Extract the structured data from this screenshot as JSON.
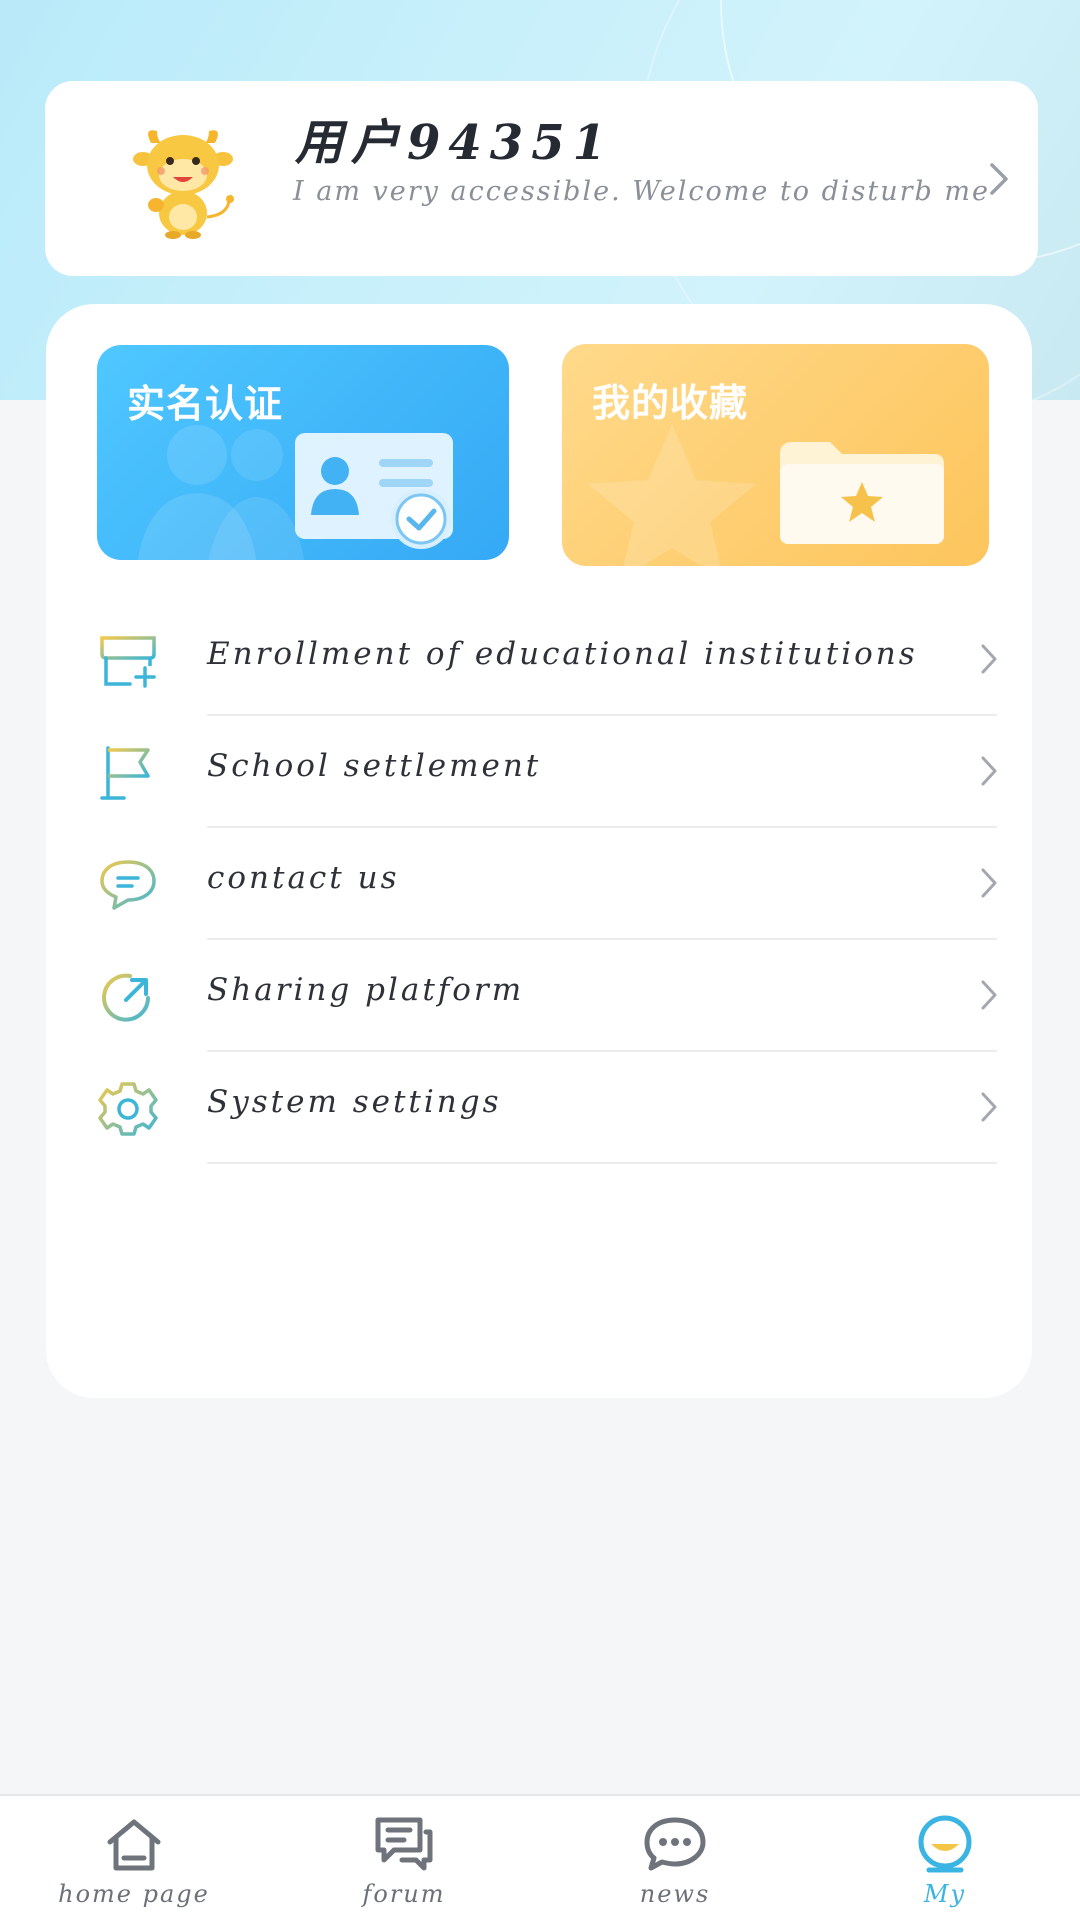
{
  "profile": {
    "username": "用户94351",
    "bio": "I am very accessible. Welcome to disturb me"
  },
  "quick_cards": {
    "verify": {
      "title": "实名认证"
    },
    "favorites": {
      "title": "我的收藏"
    }
  },
  "menu": [
    {
      "label": "Enrollment of educational institutions",
      "icon": "institution-icon"
    },
    {
      "label": "School settlement",
      "icon": "flag-icon"
    },
    {
      "label": "contact us",
      "icon": "chat-bubble-icon"
    },
    {
      "label": "Sharing platform",
      "icon": "share-icon"
    },
    {
      "label": "System settings",
      "icon": "gear-icon"
    }
  ],
  "nav": [
    {
      "label": "home page",
      "icon": "home-icon"
    },
    {
      "label": "forum",
      "icon": "forum-icon"
    },
    {
      "label": "news",
      "icon": "news-icon"
    },
    {
      "label": "My",
      "icon": "my-icon",
      "active": true
    }
  ],
  "colors": {
    "accent": "#3ab4e3",
    "verify_card": "#35a9f5",
    "favorites_card": "#fdc55c"
  }
}
